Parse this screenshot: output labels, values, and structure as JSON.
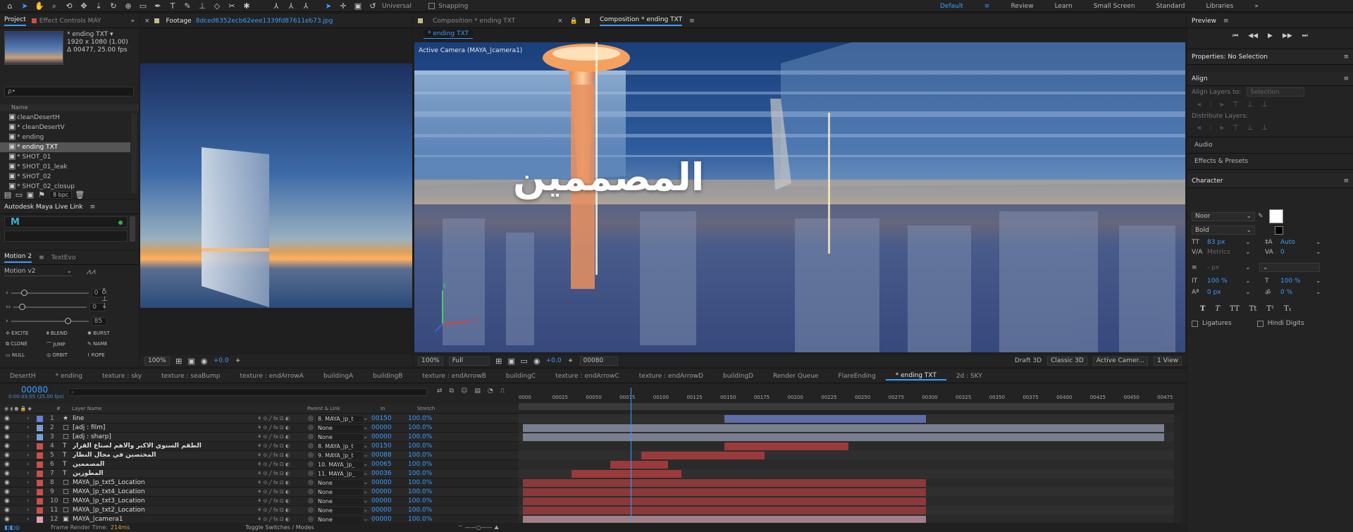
{
  "toolbar": {
    "universal": "Universal",
    "snapping": "Snapping",
    "workspaces": [
      "Default",
      "Review",
      "Learn",
      "Small Screen",
      "Standard",
      "Libraries"
    ]
  },
  "project": {
    "tab": "Project",
    "effect_tab": "Effect Controls MAY",
    "item_name": "* ending TXT ▾",
    "item_res": "1920 x 1080 (1.00)",
    "item_dur": "Δ 00477, 25.00 fps",
    "search_placeholder": "ρ•",
    "col_name": "Name",
    "items": [
      "cleanDesertH",
      "* cleanDesertV",
      "* ending",
      "* ending TXT",
      "* SHOT_01",
      "* SHOT_01_leak",
      "* SHOT_02",
      "* SHOT_02_closup"
    ],
    "bpc": "8 bpc"
  },
  "maya": {
    "title": "Autodesk Maya Live Link",
    "logo": "M"
  },
  "motion": {
    "tab": "Motion 2",
    "tab2": "TextEvo",
    "preset": "Motion v2",
    "val1": "0",
    "val2": "0",
    "val3": "85",
    "buttons": [
      "EXCITE",
      "BLEND",
      "BURST",
      "CLONE",
      "JUMP",
      "NAME",
      "NULL",
      "ORBIT",
      "ROPE"
    ]
  },
  "footage": {
    "title": "Footage",
    "file": "8dced6352ecb62eee1339fd87611eb73.jpg",
    "zoom": "100%",
    "exposure": "+0.0"
  },
  "comp": {
    "tab1": "Composition * ending TXT",
    "tab2": "Composition * ending TXT",
    "subtab": "* ending TXT",
    "camera": "Active Camera (MAYA_|camera1)",
    "arabic": "المصممين",
    "axis_x": "X",
    "axis_y": "Y",
    "zoom": "100%",
    "res": "Full",
    "exposure": "+0.0",
    "frame": "00080",
    "draft": "Draft 3D",
    "renderer": "Classic 3D",
    "view": "Active Camer...",
    "views": "1 View"
  },
  "preview": {
    "title": "Preview"
  },
  "properties": {
    "title": "Properties: No Selection"
  },
  "align": {
    "title": "Align",
    "align_to": "Align Layers to:",
    "align_to_val": "Selection",
    "distribute": "Distribute Layers:"
  },
  "audio": {
    "title": "Audio"
  },
  "effects": {
    "title": "Effects & Presets"
  },
  "character": {
    "title": "Character",
    "font": "Noor",
    "style": "Bold",
    "size": "83 px",
    "leading": "Auto",
    "kerning": "Metrics",
    "tracking": "0",
    "stroke": "- px",
    "vscale": "100 %",
    "hscale": "100 %",
    "baseline": "0 px",
    "tsume": "0 %",
    "styles": [
      "T",
      "T",
      "TT",
      "Tt",
      "T¹",
      "T₁"
    ],
    "ligatures": "Ligatures",
    "hindi": "Hindi Digits"
  },
  "timeline": {
    "tabs": [
      "DesertH",
      "* ending",
      "texture : sky",
      "texture : seaBump",
      "texture : endArrowA",
      "buildingA",
      "buildingB",
      "texture : endArrowB",
      "buildingC",
      "texture : endArrowC",
      "texture : endArrowD",
      "buildingD",
      "Render Queue",
      "FlareEnding",
      "* ending TXT",
      "2d : SKY"
    ],
    "timecode": "00080",
    "sub_timecode": "0:00:03:05 (25.00 fps)",
    "cols": {
      "num": "#",
      "name": "Layer Name",
      "parent": "Parent & Link",
      "in": "In",
      "stretch": "Stretch"
    },
    "ruler": [
      "0000",
      "00025",
      "00050",
      "00075",
      "00100",
      "00125",
      "00150",
      "00175",
      "00200",
      "00225",
      "00250",
      "00275",
      "00300",
      "00325",
      "00350",
      "00375",
      "00400",
      "00425",
      "00450",
      "00475"
    ],
    "layers": [
      {
        "num": "1",
        "type": "★",
        "name": "line",
        "parent": "8. MAYA_|p_t",
        "in": "00150",
        "stretch": "100.0%",
        "color": "#6a7fd6"
      },
      {
        "num": "2",
        "type": "□",
        "name": "[adj : film]",
        "parent": "None",
        "in": "00000",
        "stretch": "100.0%",
        "color": "#7aa0d0"
      },
      {
        "num": "3",
        "type": "□",
        "name": "[adj : sharp]",
        "parent": "None",
        "in": "00000",
        "stretch": "100.0%",
        "color": "#7aa0d0"
      },
      {
        "num": "4",
        "type": "T",
        "name": "الطقم السنوي الاكبر والاهم لصناع القرار",
        "parent": "8. MAYA_|p_t",
        "in": "00150",
        "stretch": "100.0%",
        "color": "#c8504a"
      },
      {
        "num": "5",
        "type": "T",
        "name": "المختصين في مجال النظار",
        "parent": "9. MAYA_|p_t",
        "in": "00088",
        "stretch": "100.0%",
        "color": "#c8504a"
      },
      {
        "num": "6",
        "type": "T",
        "name": "المصممين",
        "parent": "10. MAYA_|p_",
        "in": "00065",
        "stretch": "100.0%",
        "color": "#c8504a"
      },
      {
        "num": "7",
        "type": "T",
        "name": "المطورين",
        "parent": "11. MAYA_|p_",
        "in": "00036",
        "stretch": "100.0%",
        "color": "#c8504a"
      },
      {
        "num": "8",
        "type": "□",
        "name": "MAYA_|p_txt5_Location",
        "parent": "None",
        "in": "00000",
        "stretch": "100.0%",
        "color": "#c8504a"
      },
      {
        "num": "9",
        "type": "□",
        "name": "MAYA_|p_txt4_Location",
        "parent": "None",
        "in": "00000",
        "stretch": "100.0%",
        "color": "#c8504a"
      },
      {
        "num": "10",
        "type": "□",
        "name": "MAYA_|p_txt3_Location",
        "parent": "None",
        "in": "00000",
        "stretch": "100.0%",
        "color": "#c8504a"
      },
      {
        "num": "11",
        "type": "□",
        "name": "MAYA_|p_txt2_Location",
        "parent": "None",
        "in": "00000",
        "stretch": "100.0%",
        "color": "#c8504a"
      },
      {
        "num": "12",
        "type": "▣",
        "name": "MAYA_|camera1",
        "parent": "None",
        "in": "00000",
        "stretch": "100.0%",
        "color": "#e0a0b0"
      }
    ],
    "bars": [
      {
        "start": 150,
        "end": 300,
        "color": "#5f6ea8"
      },
      {
        "start": 0,
        "end": 477,
        "color": "#7a7f90"
      },
      {
        "start": 0,
        "end": 477,
        "color": "#7a7f90"
      },
      {
        "start": 150,
        "end": 242,
        "color": "#9a3a3a"
      },
      {
        "start": 88,
        "end": 180,
        "color": "#9a3a3a"
      },
      {
        "start": 65,
        "end": 108,
        "color": "#9a3a3a"
      },
      {
        "start": 36,
        "end": 118,
        "color": "#9a3a3a"
      },
      {
        "start": 0,
        "end": 300,
        "color": "#8a3a3a"
      },
      {
        "start": 0,
        "end": 300,
        "color": "#8a3a3a"
      },
      {
        "start": 0,
        "end": 300,
        "color": "#8a3a3a"
      },
      {
        "start": 0,
        "end": 300,
        "color": "#8a3a3a"
      },
      {
        "start": 0,
        "end": 300,
        "color": "#a08088"
      }
    ],
    "playhead": 80,
    "total": 477,
    "render_time_label": "Frame Render Time:",
    "render_time": "214ms",
    "toggle": "Toggle Switches / Modes"
  }
}
